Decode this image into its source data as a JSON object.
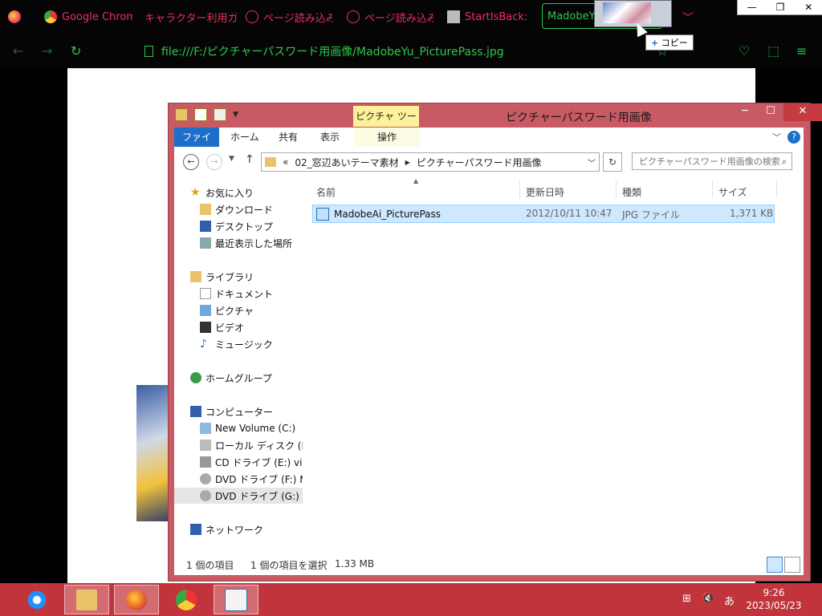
{
  "browser": {
    "tabs": [
      {
        "label": "Google Chrom",
        "icon": "chrome-icon"
      },
      {
        "label": "キャラクター利用ガイ",
        "icon": ""
      },
      {
        "label": "ページ読み込み",
        "icon": "info-icon"
      },
      {
        "label": "ページ読み込み",
        "icon": "info-icon"
      },
      {
        "label": "StartIsBack:",
        "icon": "document-icon"
      },
      {
        "label": "MadobeYu",
        "icon": ""
      }
    ],
    "url": "file:///F:/ピクチャーパスワード用画像/MadobeYu_PicturePass.jpg",
    "window_buttons": [
      "—",
      "❐",
      "✕"
    ],
    "accent": "#2ec84a",
    "tab_color": "#e8305f"
  },
  "drag": {
    "tooltip": "コピー",
    "tooltip_icon": "+"
  },
  "explorer": {
    "title": "ピクチャーパスワード用画像",
    "context_tab": "ピクチャ ツール",
    "ribbon_tabs": [
      "ファイル",
      "ホーム",
      "共有",
      "表示",
      "操作"
    ],
    "breadcrumb": [
      "«",
      "02_窓辺あいテーマ素材",
      "ピクチャーパスワード用画像"
    ],
    "search_placeholder": "ピクチャーパスワード用画像の検索",
    "nav": {
      "favorites": {
        "label": "お気に入り",
        "items": [
          "ダウンロード",
          "デスクトップ",
          "最近表示した場所"
        ]
      },
      "libraries": {
        "label": "ライブラリ",
        "items": [
          "ドキュメント",
          "ピクチャ",
          "ビデオ",
          "ミュージック"
        ]
      },
      "homegroup": "ホームグループ",
      "computer": {
        "label": "コンピューター",
        "items": [
          "New Volume (C:)",
          "ローカル ディスク (D:)",
          "CD ドライブ (E:) virt",
          "DVD ドライブ (F:) Ma",
          "DVD ドライブ (G:) M"
        ]
      },
      "network": "ネットワーク"
    },
    "columns": [
      "名前",
      "更新日時",
      "種類",
      "サイズ"
    ],
    "files": [
      {
        "name": "MadobeAi_PicturePass",
        "modified": "2012/10/11 10:47",
        "type": "JPG ファイル",
        "size": "1,371 KB"
      }
    ],
    "status": {
      "count": "1 個の項目",
      "selected": "1 個の項目を選択",
      "size": "1.33 MB"
    },
    "colors": {
      "frame": "#c85a64",
      "ribbon_file": "#1e6fc9",
      "selection": "#cde8ff"
    }
  },
  "taskbar": {
    "apps": [
      "ie-icon",
      "file-explorer-icon",
      "firefox-icon",
      "chrome-icon",
      "wordpad-icon"
    ],
    "ime": "あ",
    "time": "9:26",
    "date": "2023/05/23",
    "color": "#c1343c"
  }
}
